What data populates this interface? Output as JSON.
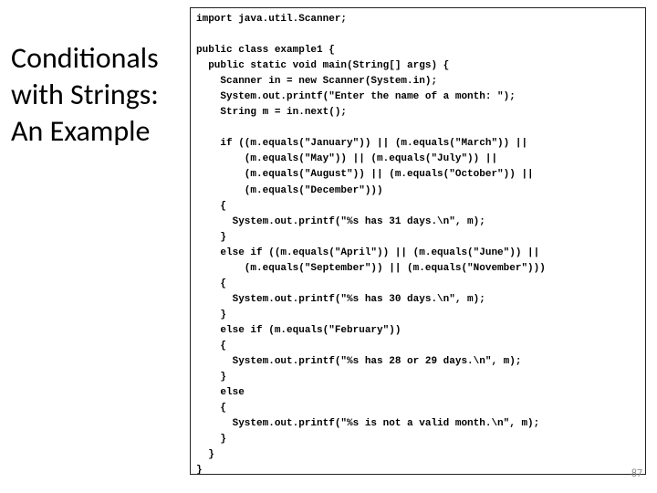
{
  "title_line1": "Conditionals",
  "title_line2": "with Strings:",
  "title_line3": "An Example",
  "page_number": "87",
  "code": "import java.util.Scanner;\n\npublic class example1 {\n  public static void main(String[] args) {\n    Scanner in = new Scanner(System.in);\n    System.out.printf(\"Enter the name of a month: \");\n    String m = in.next();\n\n    if ((m.equals(\"January\")) || (m.equals(\"March\")) ||\n        (m.equals(\"May\")) || (m.equals(\"July\")) ||\n        (m.equals(\"August\")) || (m.equals(\"October\")) ||\n        (m.equals(\"December\")))\n    {\n      System.out.printf(\"%s has 31 days.\\n\", m);\n    }\n    else if ((m.equals(\"April\")) || (m.equals(\"June\")) ||\n        (m.equals(\"September\")) || (m.equals(\"November\")))\n    {\n      System.out.printf(\"%s has 30 days.\\n\", m);\n    }\n    else if (m.equals(\"February\"))\n    {\n      System.out.printf(\"%s has 28 or 29 days.\\n\", m);\n    }\n    else\n    {\n      System.out.printf(\"%s is not a valid month.\\n\", m);\n    }\n  }\n}"
}
